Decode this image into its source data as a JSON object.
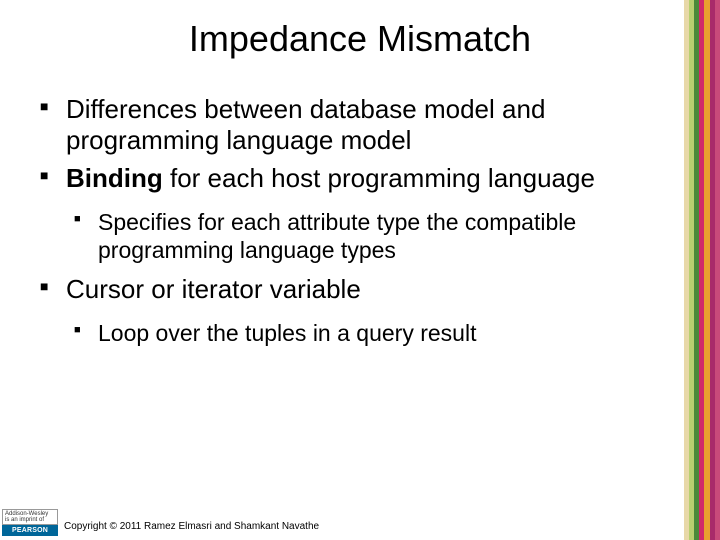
{
  "title": "Impedance Mismatch",
  "bullets": {
    "b1": "Differences between database model and programming language model",
    "b2_bold": "Binding",
    "b2_rest": " for each host programming language",
    "b2_sub1": "Specifies for each attribute type the compatible programming language types",
    "b3": "Cursor or iterator variable",
    "b3_sub1": "Loop over the tuples in a query result"
  },
  "footer": {
    "publisher_line1": "Addison-Wesley",
    "publisher_line2": "is an imprint of",
    "brand": "PEARSON",
    "copyright": "Copyright © 2011 Ramez Elmasri and Shamkant Navathe"
  }
}
